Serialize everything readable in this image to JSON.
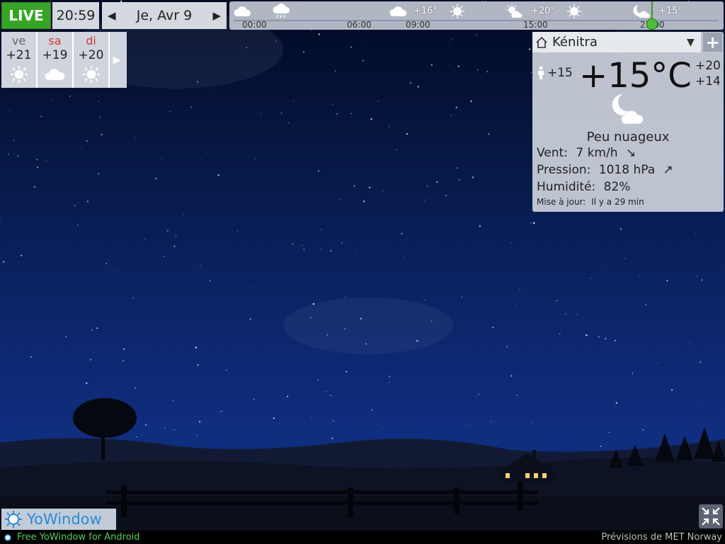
{
  "topbar": {
    "live_label": "LIVE",
    "time": "20:59",
    "date": "Je, Avr 9"
  },
  "timeline": {
    "hours": [
      "00:00",
      "06:00",
      "09:00",
      "15:00",
      "21:00"
    ],
    "temps": [
      "+16°",
      "+20°",
      "+15°"
    ],
    "icons": [
      "cloud-icon",
      "rain-cloud-icon",
      "cloud-icon",
      "sun-icon",
      "partly-cloudy-day-icon",
      "sun-icon",
      "partly-cloudy-night-icon"
    ]
  },
  "days": [
    {
      "name": "ve",
      "temp": "+21",
      "icon": "sun-icon",
      "color": "#666666"
    },
    {
      "name": "sa",
      "temp": "+19",
      "icon": "cloud-icon",
      "color": "#d03a2c"
    },
    {
      "name": "di",
      "temp": "+20",
      "icon": "sun-icon",
      "color": "#d03a2c"
    }
  ],
  "current": {
    "city": "Kénitra",
    "feels_like": "+15",
    "temperature": "+15°C",
    "high": "+20",
    "low": "+14",
    "condition": "Peu nuageux",
    "wind_label": "Vent:",
    "wind_value": "7 km/h",
    "pressure_label": "Pression:",
    "pressure_value": "1018 hPa",
    "humidity_label": "Humidité:",
    "humidity_value": "82%",
    "updated_label": "Mise à jour:",
    "updated_value": "Il y a 29 min"
  },
  "brand": {
    "name": "YoWindow"
  },
  "footer": {
    "android_link": "Free YoWindow for Android",
    "source": "Prévisions de MET Norway"
  },
  "colors": {
    "live": "#35a623",
    "sky_top": "#020a24",
    "sky_bottom": "#122f7a",
    "weekend_day": "#d03a2c",
    "brand": "#2a8ad6"
  }
}
